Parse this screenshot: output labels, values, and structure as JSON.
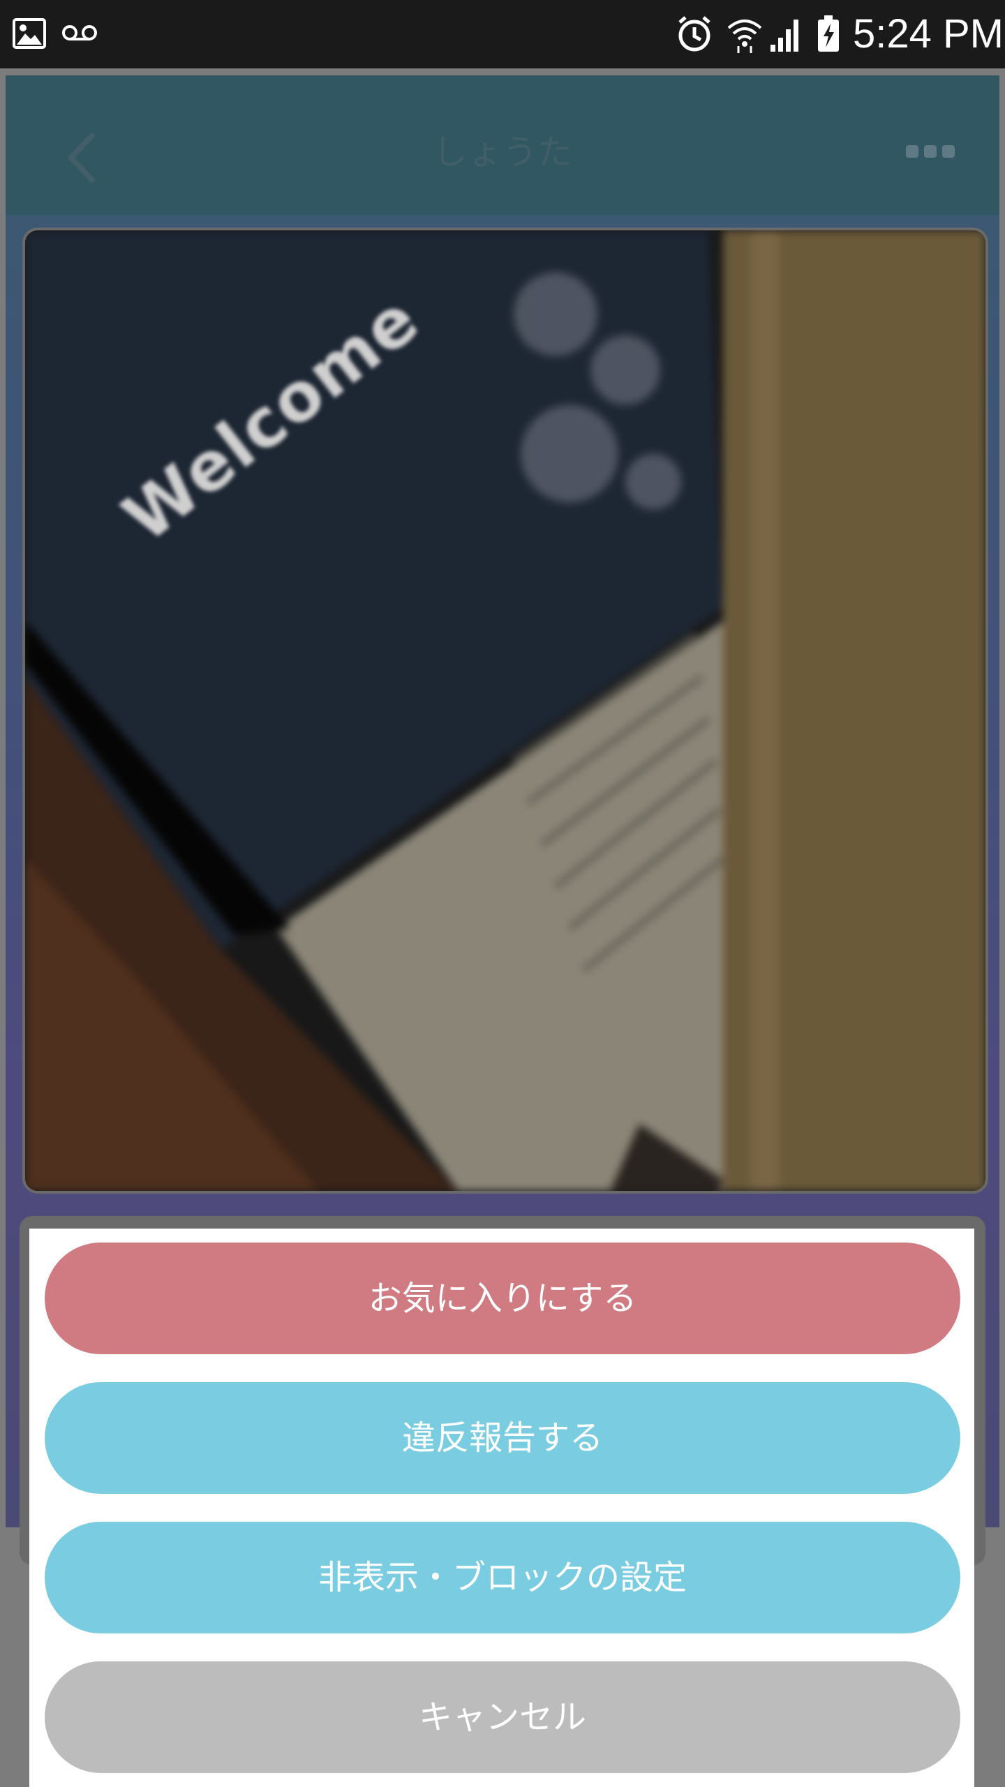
{
  "status_bar": {
    "time": "5:24 PM",
    "icons": [
      "photo-icon",
      "voicemail-icon",
      "alarm-icon",
      "wifi-icon",
      "signal-icon",
      "battery-charging-icon"
    ]
  },
  "header": {
    "title": "しょうた",
    "back_icon": "chevron-left-icon",
    "more_icon": "more-dots-icon"
  },
  "photo": {
    "caption": "Welcome"
  },
  "action_sheet": {
    "favorite_label": "お気に入りにする",
    "report_label": "違反報告する",
    "block_label": "非表示・ブロックの設定",
    "cancel_label": "キャンセル"
  },
  "colors": {
    "favorite": "#d07a82",
    "report": "#7acde0",
    "block": "#7acde0",
    "cancel": "#bcbcbc",
    "header": "#305762"
  }
}
